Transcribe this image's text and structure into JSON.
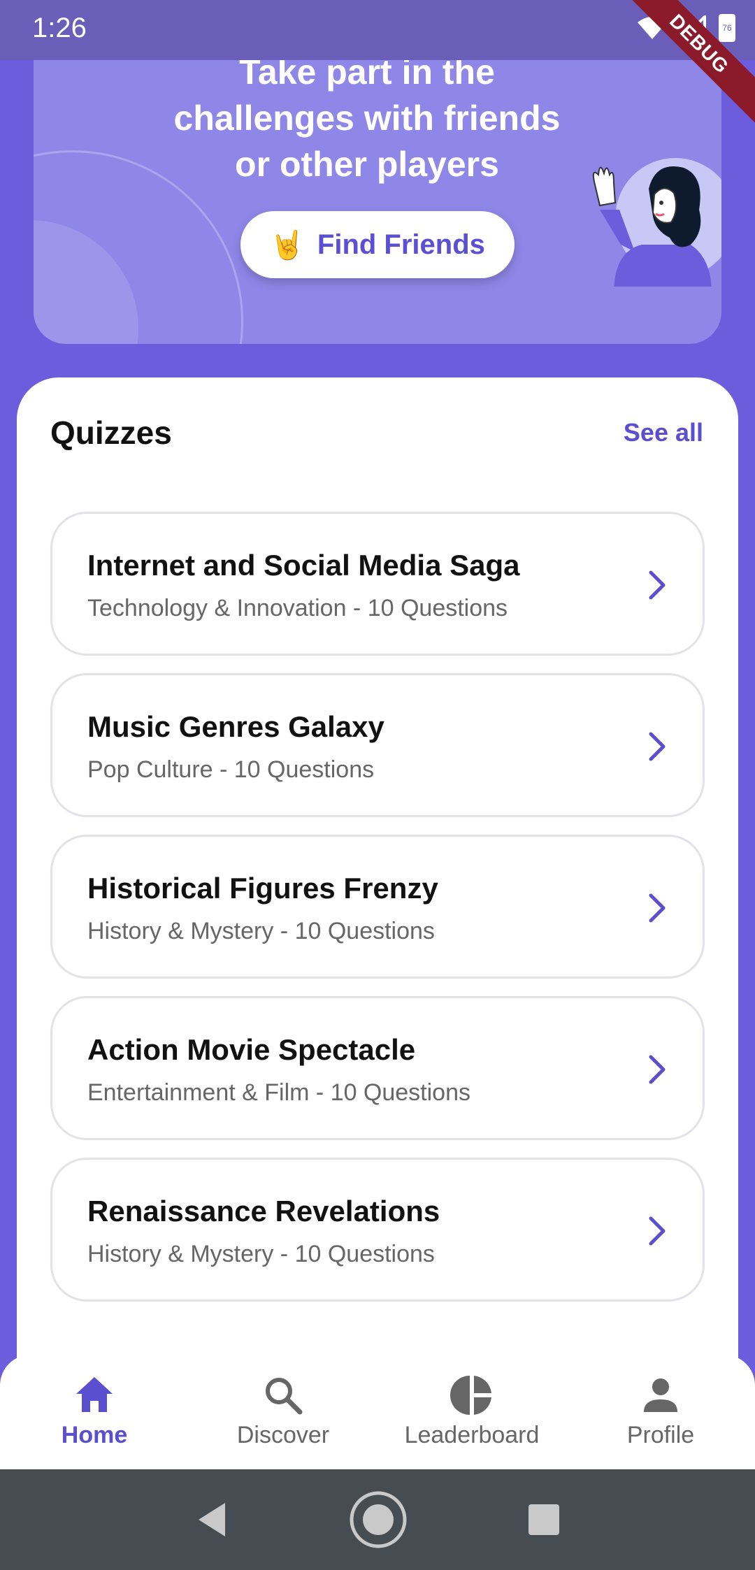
{
  "status_bar": {
    "time": "1:26",
    "battery": "76",
    "debug_label": "DEBUG"
  },
  "hero": {
    "title": "Take part in the challenges with friends or other players",
    "button_emoji": "🤘",
    "button_label": "Find Friends"
  },
  "quizzes": {
    "title": "Quizzes",
    "see_all": "See all",
    "items": [
      {
        "title": "Internet and Social Media Saga",
        "subtitle": "Technology & Innovation - 10 Questions"
      },
      {
        "title": "Music Genres Galaxy",
        "subtitle": "Pop Culture - 10 Questions"
      },
      {
        "title": "Historical Figures Frenzy",
        "subtitle": "History & Mystery - 10 Questions"
      },
      {
        "title": "Action Movie Spectacle",
        "subtitle": "Entertainment & Film - 10 Questions"
      },
      {
        "title": "Renaissance Revelations",
        "subtitle": "History & Mystery - 10 Questions"
      }
    ]
  },
  "bottom_nav": {
    "items": [
      {
        "label": "Home",
        "icon": "home-icon",
        "active": true
      },
      {
        "label": "Discover",
        "icon": "search-icon",
        "active": false
      },
      {
        "label": "Leaderboard",
        "icon": "pie-chart-icon",
        "active": false
      },
      {
        "label": "Profile",
        "icon": "person-icon",
        "active": false
      }
    ]
  },
  "colors": {
    "background": "#6B5DDC",
    "hero": "#8F87E8",
    "accent": "#5A4FCF",
    "system_nav": "#464D52"
  }
}
